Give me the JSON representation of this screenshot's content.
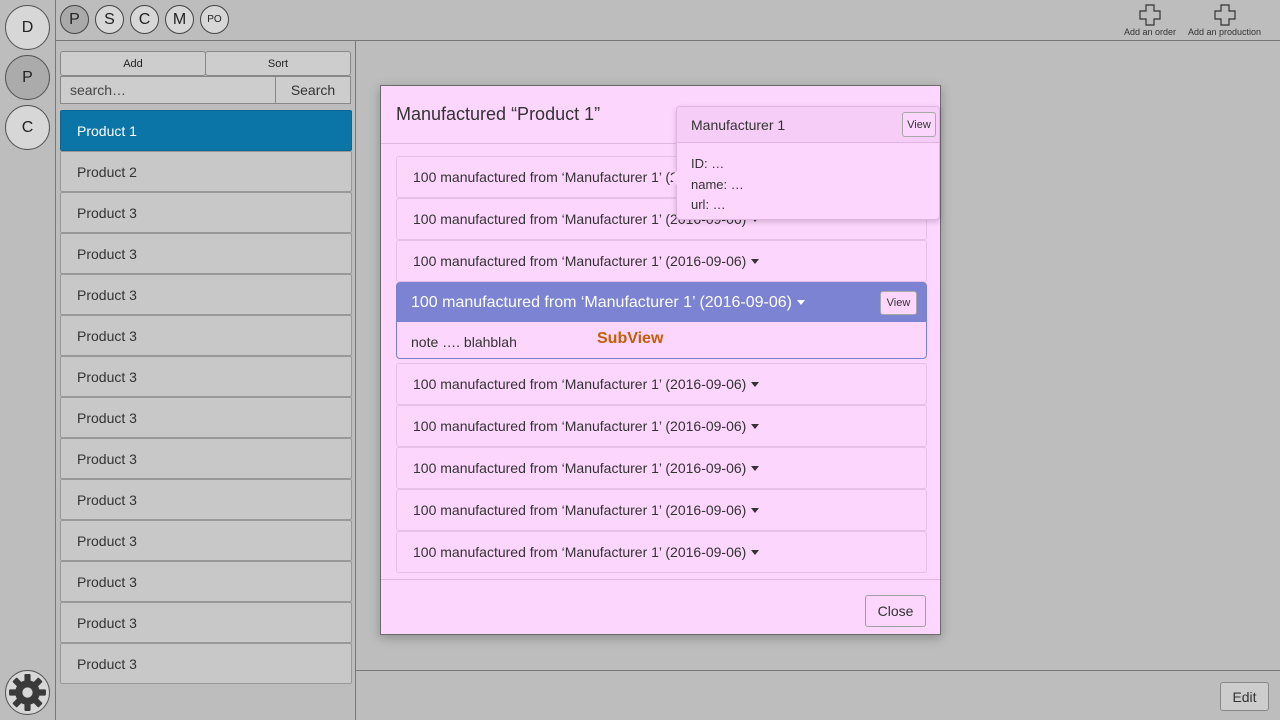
{
  "rail": {
    "items": [
      {
        "label": "D"
      },
      {
        "label": "P"
      },
      {
        "label": "C"
      }
    ]
  },
  "topbar": {
    "tabs": [
      {
        "label": "P"
      },
      {
        "label": "S"
      },
      {
        "label": "C"
      },
      {
        "label": "M"
      },
      {
        "label": "PO"
      }
    ],
    "add_order_label": "Add an order",
    "add_production_label": "Add an production"
  },
  "sidebar": {
    "add_label": "Add",
    "sort_label": "Sort",
    "search_placeholder": "search…",
    "search_button": "Search",
    "products": [
      "Product 1",
      "Product 2",
      "Product 3",
      "Product 3",
      "Product 3",
      "Product 3",
      "Product 3",
      "Product 3",
      "Product 3",
      "Product 3",
      "Product 3",
      "Product 3",
      "Product 3",
      "Product 3"
    ]
  },
  "modal": {
    "title": "Manufactured “Product 1”",
    "rows_before": [
      "100 manufactured from ‘Manufacturer 1’ (2016-09-06)",
      "100 manufactured from ‘Manufacturer 1’ (2016-09-06)",
      "100 manufactured from ‘Manufacturer 1’ (2016-09-06)"
    ],
    "expanded": {
      "label": "100 manufactured from ‘Manufacturer 1’ (2016-09-06)",
      "view_label": "View",
      "note": "note …. blahblah",
      "subview": "SubView"
    },
    "rows_after": [
      "100 manufactured from ‘Manufacturer 1’ (2016-09-06)",
      "100 manufactured from ‘Manufacturer 1’ (2016-09-06)",
      "100 manufactured from ‘Manufacturer 1’ (2016-09-06)",
      "100 manufactured from ‘Manufacturer 1’ (2016-09-06)",
      "100 manufactured from ‘Manufacturer 1’ (2016-09-06)"
    ],
    "close_label": "Close"
  },
  "popover": {
    "title": "Manufacturer 1",
    "view_label": "View",
    "fields": [
      "ID: …",
      "name: …",
      "url: …"
    ]
  },
  "bottombar": {
    "edit_label": "Edit"
  },
  "colors": {
    "background": "#bdbdbd",
    "modal_bg": "#fdd6fd",
    "selected_item": "#0b75a8",
    "expanded_header": "#7b83d2",
    "subview_text": "#c35e07"
  }
}
